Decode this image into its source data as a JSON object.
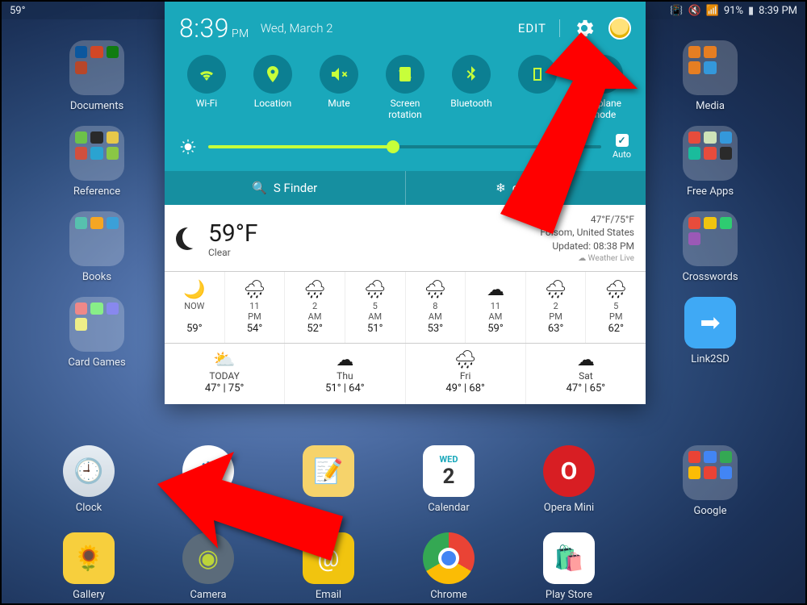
{
  "status": {
    "left_temp": "59°",
    "battery_pct": "91%",
    "clock": "8:39 PM"
  },
  "home_icons": {
    "left": [
      "Documents",
      "Reference",
      "Books",
      "Card Games"
    ],
    "right": [
      "Media",
      "Free Apps",
      "Crosswords",
      "Link2SD"
    ],
    "dock": [
      "Clock",
      "Settings",
      "",
      "Email",
      "",
      "Calendar",
      "Chrome",
      "Opera Mini",
      "Play Store",
      "Google",
      ""
    ],
    "bottom": [
      "Gallery",
      "Camera"
    ],
    "calendar_day_label": "WED",
    "calendar_day_num": "2"
  },
  "panel": {
    "time": "8:39",
    "ampm": "PM",
    "date": "Wed, March 2",
    "edit": "EDIT",
    "brightness_auto": "Auto",
    "sfinder": "S Finder",
    "quickconnect": "connect",
    "qs": [
      {
        "label": "Wi-Fi",
        "on": true
      },
      {
        "label": "Location",
        "on": true
      },
      {
        "label": "Mute",
        "on": true
      },
      {
        "label": "Screen\nrotation",
        "on": true
      },
      {
        "label": "Bluetooth",
        "on": true
      },
      {
        "label": "",
        "on": true
      },
      {
        "label": "Airplane\nmode",
        "on": false
      }
    ]
  },
  "weather": {
    "now_temp": "59°F",
    "now_cond": "Clear",
    "hi_lo": "47°F/75°F",
    "location": "Folsom, United States",
    "updated": "Updated: 08:38 PM",
    "provider": "Weather Live",
    "hourly": [
      {
        "label": "NOW",
        "icon": "moon",
        "temp": "59°"
      },
      {
        "label": "11 PM",
        "icon": "rain",
        "temp": "54°"
      },
      {
        "label": "2 AM",
        "icon": "rain",
        "temp": "52°"
      },
      {
        "label": "5 AM",
        "icon": "rain",
        "temp": "51°"
      },
      {
        "label": "8 AM",
        "icon": "rain",
        "temp": "53°"
      },
      {
        "label": "11 AM",
        "icon": "cloud",
        "temp": "59°"
      },
      {
        "label": "2 PM",
        "icon": "rain",
        "temp": "63°"
      },
      {
        "label": "5 PM",
        "icon": "rain",
        "temp": "62°"
      }
    ],
    "daily": [
      {
        "day": "TODAY",
        "icon": "partly",
        "hl": "47° | 75°"
      },
      {
        "day": "Thu",
        "icon": "cloud",
        "hl": "51° | 64°"
      },
      {
        "day": "Fri",
        "icon": "rain",
        "hl": "49° | 68°"
      },
      {
        "day": "Sat",
        "icon": "cloud",
        "hl": "47° | 65°"
      }
    ]
  }
}
